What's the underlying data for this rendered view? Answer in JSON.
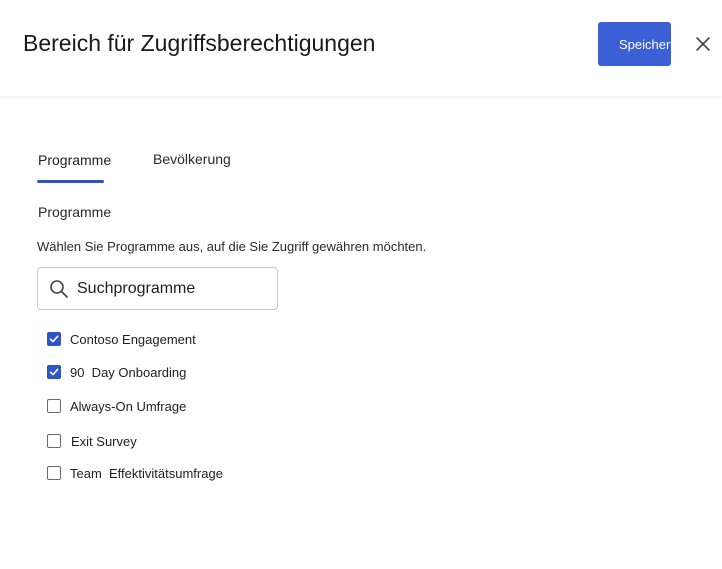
{
  "header": {
    "title": "Bereich für Zugriffsberechtigungen",
    "save_label": "Speichern",
    "close_icon": "close-icon"
  },
  "tabs": [
    {
      "label": "Programme",
      "selected": true
    },
    {
      "label": "Bevölkerung",
      "selected": false
    }
  ],
  "section": {
    "heading": "Programme",
    "description": "Wählen Sie Programme aus, auf die Sie Zugriff gewähren möchten."
  },
  "search": {
    "placeholder": "Suchprogramme",
    "value": "",
    "icon": "search-icon"
  },
  "programs": [
    {
      "label": "Contoso Engagement",
      "checked": true
    },
    {
      "label": "90  Day Onboarding",
      "checked": true
    },
    {
      "label": "Always-On Umfrage",
      "checked": false
    },
    {
      "label": "Exit Survey",
      "checked": false
    },
    {
      "label": "Team  Effektivitätsumfrage",
      "checked": false
    }
  ],
  "colors": {
    "accent": "#2f54c5",
    "button": "#3b5fd4"
  }
}
